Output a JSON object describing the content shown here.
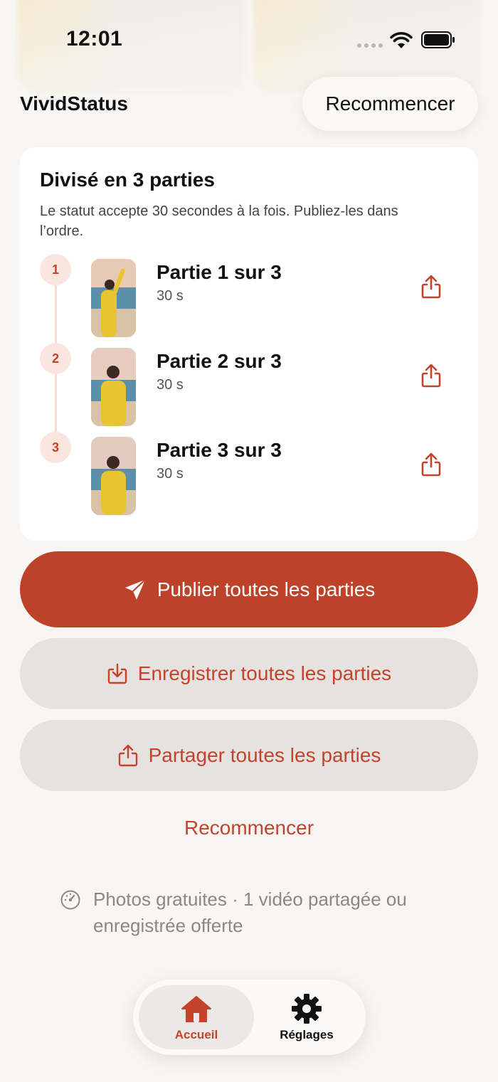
{
  "status_bar": {
    "time": "12:01"
  },
  "header": {
    "app_title": "VividStatus",
    "restart_label": "Recommencer"
  },
  "card": {
    "title": "Divisé en 3 parties",
    "description": "Le statut accepte 30 secondes à la fois. Publiez-les dans l’ordre.",
    "parts": [
      {
        "step": "1",
        "title": "Partie 1 sur 3",
        "duration": "30 s"
      },
      {
        "step": "2",
        "title": "Partie 2 sur 3",
        "duration": "30 s"
      },
      {
        "step": "3",
        "title": "Partie 3 sur 3",
        "duration": "30 s"
      }
    ]
  },
  "actions": {
    "publish_all": "Publier toutes les parties",
    "save_all": "Enregistrer toutes les parties",
    "share_all": "Partager toutes les parties",
    "restart": "Recommencer"
  },
  "free_note": "Photos gratuites · 1 vidéo partagée ou enregistrée offerte",
  "tab_bar": {
    "home_label": "Accueil",
    "settings_label": "Réglages"
  },
  "colors": {
    "accent": "#be4129",
    "accent_text": "#c4432b",
    "background": "#f8f6f4",
    "secondary_button": "#e5e2df"
  },
  "icons": {
    "share": "share-icon",
    "publish": "paper-plane-icon",
    "save": "download-tray-icon",
    "info": "dial-icon",
    "home": "house-icon",
    "settings": "gear-icon"
  }
}
